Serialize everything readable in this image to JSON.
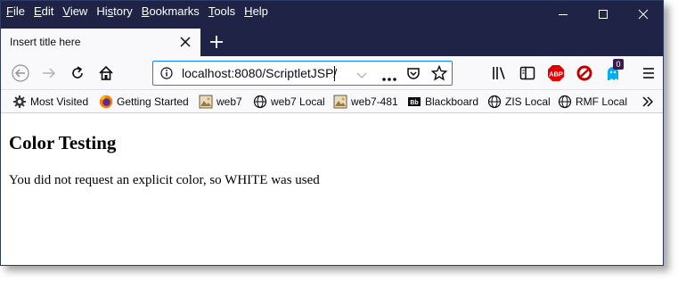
{
  "menubar": {
    "items": [
      {
        "label_ul": "F",
        "label_rest": "ile"
      },
      {
        "label_ul": "E",
        "label_rest": "dit"
      },
      {
        "label_ul": "V",
        "label_rest": "iew"
      },
      {
        "label_pre": "Hi",
        "label_ul": "s",
        "label_rest": "tory"
      },
      {
        "label_ul": "B",
        "label_rest": "ookmarks"
      },
      {
        "label_ul": "T",
        "label_rest": "ools"
      },
      {
        "label_ul": "H",
        "label_rest": "elp"
      }
    ]
  },
  "tab": {
    "title": "Insert title here"
  },
  "urlbar": {
    "url": "localhost:8080/ScriptletJSP/"
  },
  "toolbar": {
    "notification_badge": "0"
  },
  "bookmarks": {
    "items": [
      {
        "label": "Most Visited",
        "icon": "gear-icon"
      },
      {
        "label": "Getting Started",
        "icon": "firefox-icon"
      },
      {
        "label": "web7",
        "icon": "image-icon"
      },
      {
        "label": "web7 Local",
        "icon": "globe-icon"
      },
      {
        "label": "web7-481",
        "icon": "image-icon"
      },
      {
        "label": "Blackboard",
        "icon": "blackboard-icon"
      },
      {
        "label": "ZIS Local",
        "icon": "globe-icon"
      },
      {
        "label": "RMF Local",
        "icon": "globe-icon"
      }
    ]
  },
  "page": {
    "heading": "Color Testing",
    "message": "You did not request an explicit color, so WHITE was used"
  },
  "colors": {
    "titlebar": "#1f2447",
    "url_focus": "#0a84ff",
    "abp": "#e40000",
    "badge": "#3b1a4f"
  }
}
